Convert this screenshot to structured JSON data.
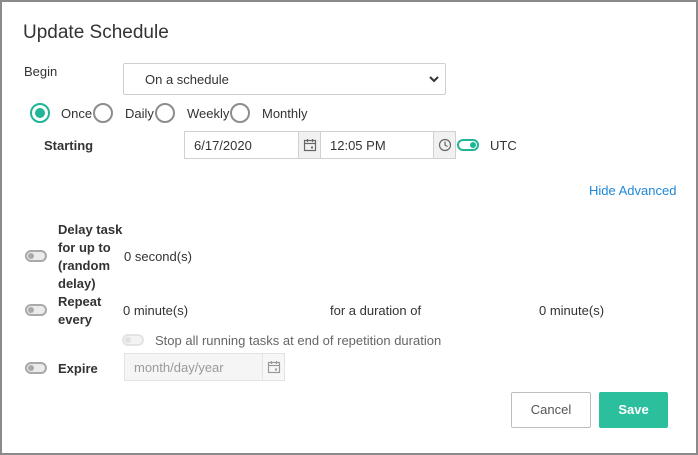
{
  "dialog": {
    "title": "Update Schedule"
  },
  "begin": {
    "label": "Begin",
    "selected": "On a schedule"
  },
  "frequency": {
    "options": [
      {
        "label": "Once",
        "checked": true
      },
      {
        "label": "Daily",
        "checked": false
      },
      {
        "label": "Weekly",
        "checked": false
      },
      {
        "label": "Monthly",
        "checked": false
      }
    ]
  },
  "starting": {
    "label": "Starting",
    "date": "6/17/2020",
    "time": "12:05 PM",
    "utc_label": "UTC",
    "utc_on": true
  },
  "advanced": {
    "toggle_link": "Hide Advanced"
  },
  "delay": {
    "label_lines": [
      "Delay task",
      "for up to",
      "(random",
      "delay)"
    ],
    "value": "0 second(s)",
    "enabled": false
  },
  "repeat": {
    "label_lines": [
      "Repeat",
      "every"
    ],
    "interval": "0 minute(s)",
    "duration_label": "for a duration of",
    "duration": "0 minute(s)",
    "enabled": false,
    "stop_label": "Stop all running tasks at end of repetition duration"
  },
  "expire": {
    "label": "Expire",
    "placeholder": "month/day/year",
    "enabled": false
  },
  "footer": {
    "cancel_label": "Cancel",
    "save_label": "Save"
  },
  "colors": {
    "accent": "#1fb596",
    "link": "#1e88d8",
    "save_button": "#2bbf9d"
  },
  "icons": {
    "select_arrow": "chevron-down-icon",
    "date_picker": "calendar-icon",
    "time_picker": "clock-icon"
  }
}
